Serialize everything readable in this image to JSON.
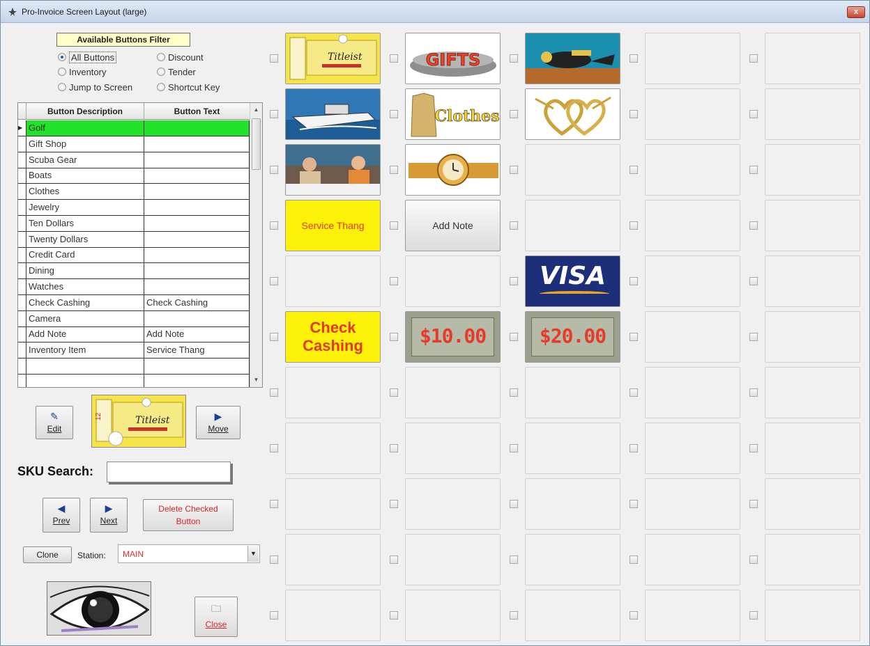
{
  "window": {
    "title": "Pro-Invoice Screen Layout (large)",
    "close_label": "x"
  },
  "filter": {
    "legend": "Available Buttons Filter",
    "options": [
      "All Buttons",
      "Discount",
      "Inventory",
      "Tender",
      "Jump to Screen",
      "Shortcut Key"
    ],
    "selected": "All Buttons"
  },
  "grid": {
    "headers": [
      "Button Description",
      "Button Text"
    ],
    "rows": [
      {
        "desc": "Golf",
        "text": ""
      },
      {
        "desc": "Gift Shop",
        "text": ""
      },
      {
        "desc": "Scuba Gear",
        "text": ""
      },
      {
        "desc": "Boats",
        "text": ""
      },
      {
        "desc": "Clothes",
        "text": ""
      },
      {
        "desc": "Jewelry",
        "text": ""
      },
      {
        "desc": "Ten Dollars",
        "text": ""
      },
      {
        "desc": "Twenty Dollars",
        "text": ""
      },
      {
        "desc": "Credit Card",
        "text": ""
      },
      {
        "desc": "Dining",
        "text": ""
      },
      {
        "desc": "Watches",
        "text": ""
      },
      {
        "desc": "Check Cashing",
        "text": "Check Cashing"
      },
      {
        "desc": "Camera",
        "text": ""
      },
      {
        "desc": "Add Note",
        "text": "Add Note"
      },
      {
        "desc": "Inventory Item",
        "text": "Service Thang"
      },
      {
        "desc": "",
        "text": ""
      },
      {
        "desc": "",
        "text": ""
      }
    ]
  },
  "buttons": {
    "edit": "Edit",
    "move": "Move",
    "prev": "Prev",
    "next": "Next",
    "delete_checked": "Delete Checked Button",
    "clone": "Clone",
    "close": "Close"
  },
  "sku": {
    "label": "SKU Search:",
    "value": ""
  },
  "station": {
    "label": "Station:",
    "value": "MAIN"
  },
  "matrix": {
    "service_thang": "Service Thang",
    "add_note": "Add Note",
    "check_cashing": "Check Cashing",
    "gifts_text": "GIFTS",
    "clothes_text": "Clothes",
    "visa_text": "VISA",
    "ten_dollars": "$10.00",
    "twenty_dollars": "$20.00",
    "golf_brand": "Titleist",
    "golf_count": "12"
  },
  "colors": {
    "grid_current": "#22e22a",
    "yellow_button": "#fdf10a",
    "red_text": "#e23a1f",
    "visa_blue": "#1d2f78"
  }
}
